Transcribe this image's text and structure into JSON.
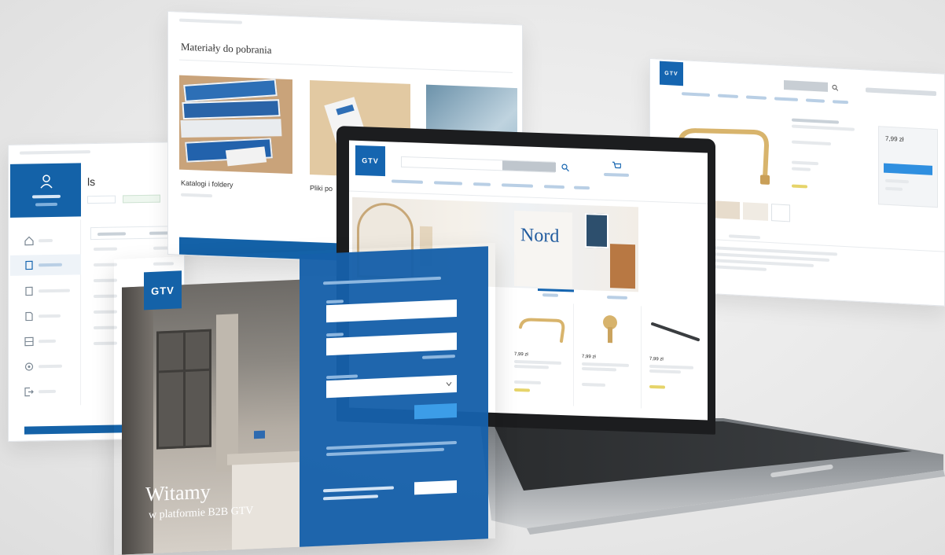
{
  "brand": {
    "logo_text": "GTV",
    "primary_color": "#1565b0",
    "accent_color": "#2f8fe0"
  },
  "materials_panel": {
    "title": "Materiały do pobrania",
    "items": [
      {
        "label": "Katalogi i foldery"
      },
      {
        "label": "Pliki po"
      }
    ]
  },
  "login_panel": {
    "welcome_line1": "Witamy",
    "welcome_line2": "w platformie B2B GTV"
  },
  "product_panel": {
    "price": "7,99 zł",
    "price_box": "7,99 zł"
  },
  "laptop_page": {
    "hero_text": "Nord",
    "prices": [
      "7,99 zł",
      "7,99 zł",
      "7,99 zł"
    ]
  },
  "icons": [
    "user-icon",
    "search-icon",
    "cart-icon",
    "home-icon",
    "file-icon",
    "grid-icon",
    "gear-icon",
    "logout-icon"
  ]
}
